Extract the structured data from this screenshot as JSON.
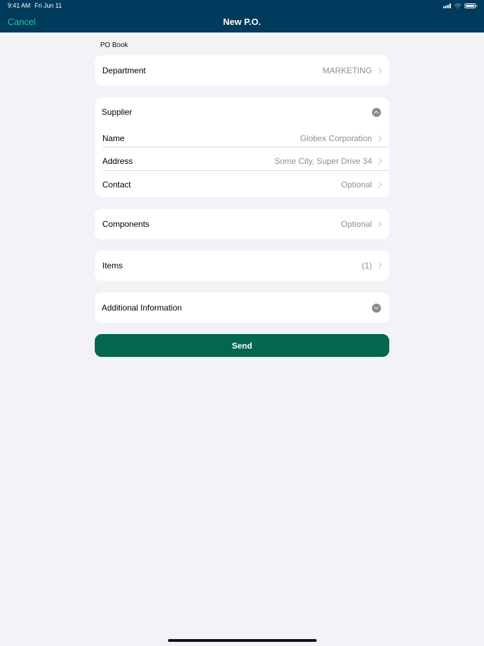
{
  "status_bar": {
    "time": "9:41 AM",
    "date": "Fri Jun 11"
  },
  "nav": {
    "cancel_label": "Cancel",
    "title": "New P.O."
  },
  "po_book": {
    "section_label": "PO Book",
    "department": {
      "label": "Department",
      "value": "MARKETING"
    }
  },
  "supplier": {
    "header": "Supplier",
    "expanded": true,
    "rows": [
      {
        "label": "Name",
        "value": "Globex Corporation"
      },
      {
        "label": "Address",
        "value": "Some City, Super Drive 34"
      },
      {
        "label": "Contact",
        "value": "Optional"
      }
    ]
  },
  "components": {
    "label": "Components",
    "value": "Optional"
  },
  "items": {
    "label": "Items",
    "value": "(1)"
  },
  "additional_info": {
    "header": "Additional Information",
    "expanded": false
  },
  "send_label": "Send",
  "colors": {
    "header_bg": "#003a5c",
    "accent": "#2ec4a7",
    "send_bg": "#03664f",
    "background": "#f2f2f7"
  }
}
